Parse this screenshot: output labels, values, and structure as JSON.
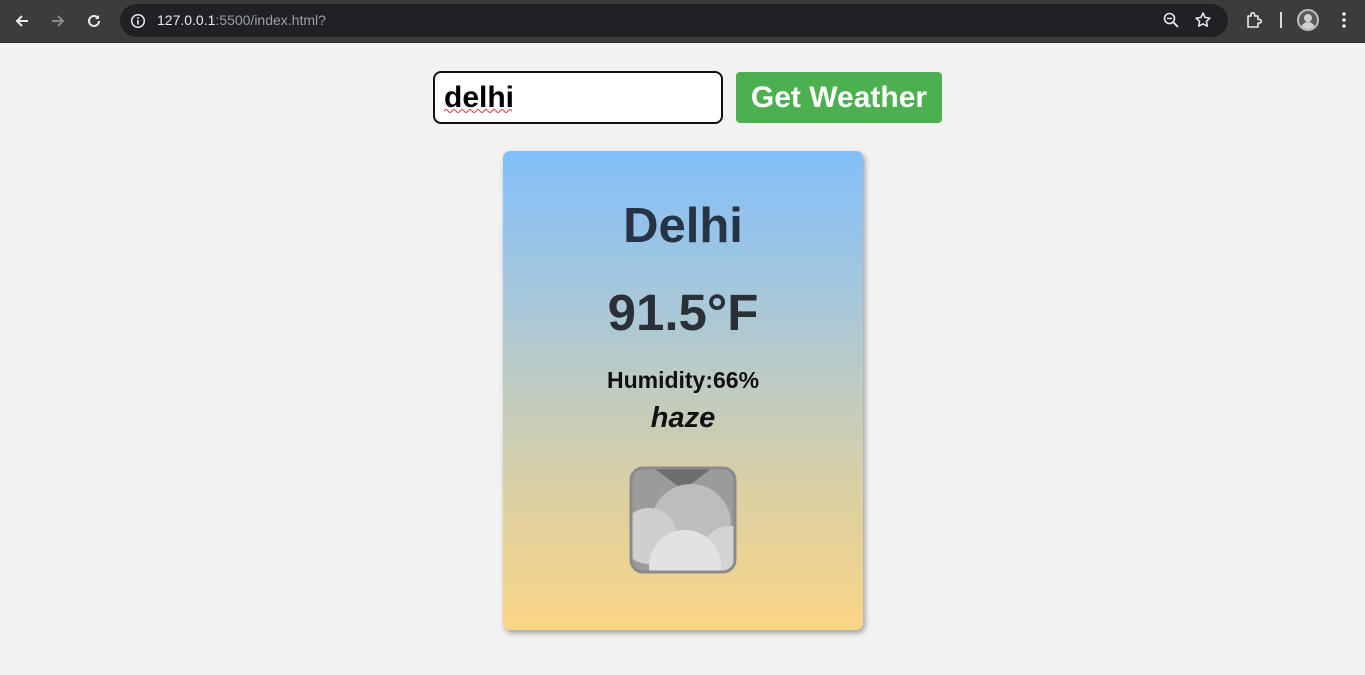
{
  "browser": {
    "url_host": "127.0.0.1",
    "url_path": ":5500/index.html?"
  },
  "search": {
    "value": "delhi",
    "button_label": "Get Weather"
  },
  "weather": {
    "city": "Delhi",
    "temperature": "91.5°F",
    "humidity": "Humidity:66%",
    "description": "haze",
    "icon": "haze-cloud-icon"
  },
  "colors": {
    "button": "#4caf50",
    "card_top": "#83bffb",
    "card_bottom": "#fad586"
  }
}
